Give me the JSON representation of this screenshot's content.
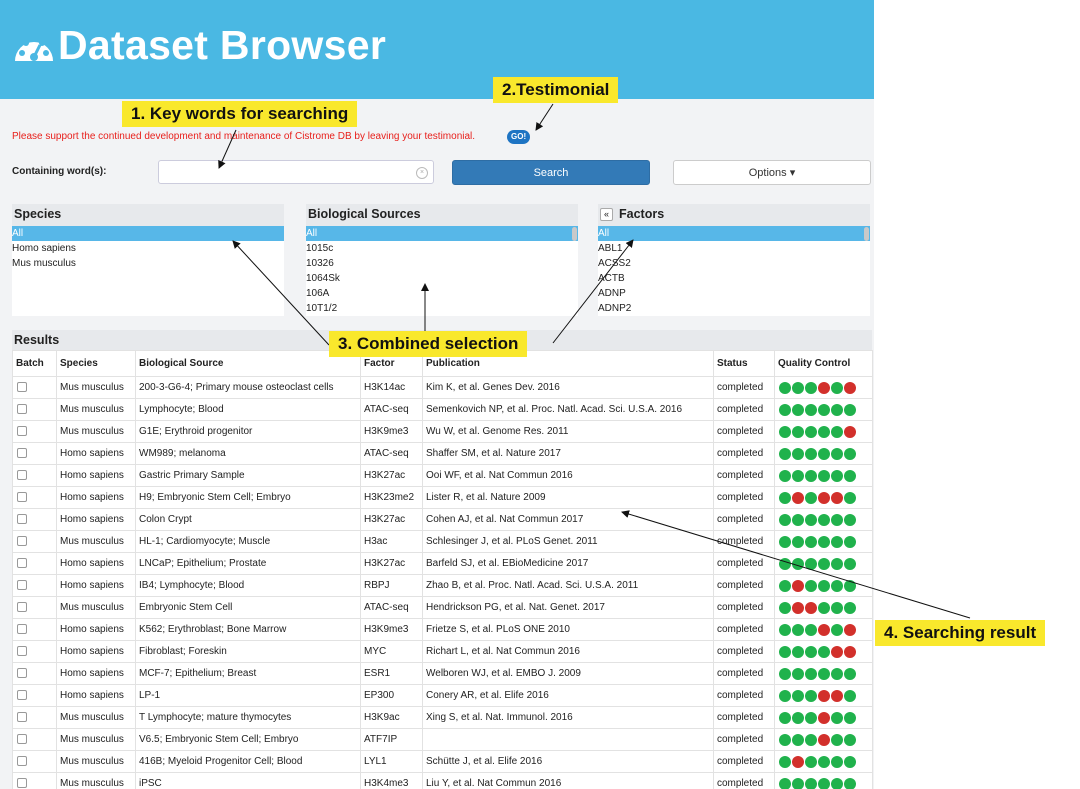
{
  "header": {
    "title": "Dataset Browser",
    "logo_icon": "speedometer-icon"
  },
  "notice": {
    "text": "Please support the continued development and maintenance of Cistrome DB by leaving your testimonial.",
    "go_label": "GO!"
  },
  "search": {
    "label": "Containing word(s):",
    "value": "",
    "placeholder": "",
    "button_label": "Search",
    "options_label": "Options ▾"
  },
  "panels": {
    "species": {
      "title": "Species",
      "items": [
        "All",
        "Homo sapiens",
        "Mus musculus"
      ],
      "selected": "All"
    },
    "biological_sources": {
      "title": "Biological Sources",
      "items": [
        "All",
        "1015c",
        "10326",
        "1064Sk",
        "106A",
        "10T1/2"
      ],
      "selected": "All"
    },
    "factors": {
      "title": "Factors",
      "items": [
        "All",
        "ABL1",
        "ACSS2",
        "ACTB",
        "ADNP",
        "ADNP2"
      ],
      "selected": "All",
      "collapse_icon": "«"
    }
  },
  "results": {
    "title": "Results",
    "columns": [
      "Batch",
      "Species",
      "Biological Source",
      "Factor",
      "Publication",
      "Status",
      "Quality Control"
    ],
    "rows": [
      {
        "species": "Mus musculus",
        "source": "200-3-G6-4; Primary mouse osteoclast cells",
        "factor": "H3K14ac",
        "publication": "Kim K, et al. Genes Dev. 2016",
        "status": "completed",
        "qc": "GGGRGR"
      },
      {
        "species": "Mus musculus",
        "source": "Lymphocyte; Blood",
        "factor": "ATAC-seq",
        "publication": "Semenkovich NP, et al. Proc. Natl. Acad. Sci. U.S.A. 2016",
        "status": "completed",
        "qc": "GGGGGG"
      },
      {
        "species": "Mus musculus",
        "source": "G1E; Erythroid progenitor",
        "factor": "H3K9me3",
        "publication": "Wu W, et al. Genome Res. 2011",
        "status": "completed",
        "qc": "GGGGGR"
      },
      {
        "species": "Homo sapiens",
        "source": "WM989; melanoma",
        "factor": "ATAC-seq",
        "publication": "Shaffer SM, et al. Nature 2017",
        "status": "completed",
        "qc": "GGGGGG"
      },
      {
        "species": "Homo sapiens",
        "source": "Gastric Primary Sample",
        "factor": "H3K27ac",
        "publication": "Ooi WF, et al. Nat Commun 2016",
        "status": "completed",
        "qc": "GGGGGG"
      },
      {
        "species": "Homo sapiens",
        "source": "H9; Embryonic Stem Cell; Embryo",
        "factor": "H3K23me2",
        "publication": "Lister R, et al. Nature 2009",
        "status": "completed",
        "qc": "GRGRRG"
      },
      {
        "species": "Homo sapiens",
        "source": "Colon Crypt",
        "factor": "H3K27ac",
        "publication": "Cohen AJ, et al. Nat Commun 2017",
        "status": "completed",
        "qc": "GGGGGG"
      },
      {
        "species": "Mus musculus",
        "source": "HL-1; Cardiomyocyte; Muscle",
        "factor": "H3ac",
        "publication": "Schlesinger J, et al. PLoS Genet. 2011",
        "status": "completed",
        "qc": "GGGGGG"
      },
      {
        "species": "Homo sapiens",
        "source": "LNCaP; Epithelium; Prostate",
        "factor": "H3K27ac",
        "publication": "Barfeld SJ, et al. EBioMedicine 2017",
        "status": "completed",
        "qc": "GGGGGG"
      },
      {
        "species": "Homo sapiens",
        "source": "IB4; Lymphocyte; Blood",
        "factor": "RBPJ",
        "publication": "Zhao B, et al. Proc. Natl. Acad. Sci. U.S.A. 2011",
        "status": "completed",
        "qc": "GRGGGG"
      },
      {
        "species": "Mus musculus",
        "source": "Embryonic Stem Cell",
        "factor": "ATAC-seq",
        "publication": "Hendrickson PG, et al. Nat. Genet. 2017",
        "status": "completed",
        "qc": "GRRGGG"
      },
      {
        "species": "Homo sapiens",
        "source": "K562; Erythroblast; Bone Marrow",
        "factor": "H3K9me3",
        "publication": "Frietze S, et al. PLoS ONE 2010",
        "status": "completed",
        "qc": "GGGRGR"
      },
      {
        "species": "Homo sapiens",
        "source": "Fibroblast; Foreskin",
        "factor": "MYC",
        "publication": "Richart L, et al. Nat Commun 2016",
        "status": "completed",
        "qc": "GGGGRR"
      },
      {
        "species": "Homo sapiens",
        "source": "MCF-7; Epithelium; Breast",
        "factor": "ESR1",
        "publication": "Welboren WJ, et al. EMBO J. 2009",
        "status": "completed",
        "qc": "GGGGGG"
      },
      {
        "species": "Homo sapiens",
        "source": "LP-1",
        "factor": "EP300",
        "publication": "Conery AR, et al. Elife 2016",
        "status": "completed",
        "qc": "GGGRRG"
      },
      {
        "species": "Mus musculus",
        "source": "T Lymphocyte; mature thymocytes",
        "factor": "H3K9ac",
        "publication": "Xing S, et al. Nat. Immunol. 2016",
        "status": "completed",
        "qc": "GGGRGG"
      },
      {
        "species": "Mus musculus",
        "source": "V6.5; Embryonic Stem Cell; Embryo",
        "factor": "ATF7IP",
        "publication": "",
        "status": "completed",
        "qc": "GGGRGG"
      },
      {
        "species": "Mus musculus",
        "source": "416B; Myeloid Progenitor Cell; Blood",
        "factor": "LYL1",
        "publication": "Schütte J, et al. Elife 2016",
        "status": "completed",
        "qc": "GRGGGG"
      },
      {
        "species": "Mus musculus",
        "source": "iPSC",
        "factor": "H3K4me3",
        "publication": "Liu Y, et al. Nat Commun 2016",
        "status": "completed",
        "qc": "GGGGGG"
      }
    ]
  },
  "annotations": {
    "keywords": "1. Key words for searching",
    "testimonial": "2.Testimonial",
    "combined": "3. Combined selection",
    "result": "4. Searching result"
  },
  "colors": {
    "header": "#4ab8e3",
    "selected": "#57b7e8",
    "qc_pass": "#20b24c",
    "qc_fail": "#d2302b",
    "notice": "#e8201c",
    "annotation": "#f9e82c"
  }
}
